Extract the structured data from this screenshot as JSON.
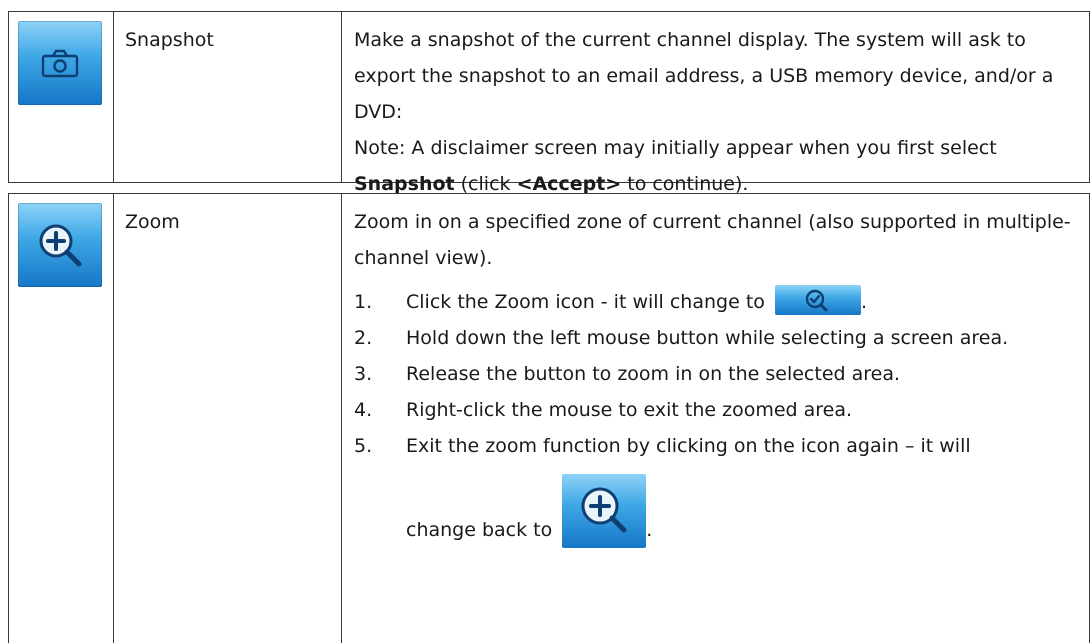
{
  "rows": [
    {
      "icon": "camera-icon",
      "name": "Snapshot",
      "description": {
        "line1": "Make a snapshot of the current channel display. The system will ask to export the snapshot to an email address, a USB memory device, and/or a DVD:",
        "note_prefix": "Note: A disclaimer screen may initially appear when you first select ",
        "note_bold1": "Snapshot",
        "note_mid": " (click ",
        "note_bold2": "<Accept>",
        "note_suffix": " to continue)."
      }
    },
    {
      "icon": "zoom-in-icon",
      "name": "Zoom",
      "description": {
        "intro": "Zoom in on a specified zone of current channel (also supported in multiple-channel view).",
        "steps": [
          {
            "num": "1.",
            "text": "Click the Zoom icon - it will change to ",
            "trailing": ".",
            "inline_icon": "zoom-active-icon"
          },
          {
            "num": "2.",
            "text": "Hold down the left mouse button while selecting a screen area."
          },
          {
            "num": "3.",
            "text": "Release the button to zoom in on the selected area."
          },
          {
            "num": "4.",
            "text": "Right-click the mouse to exit the zoomed area."
          },
          {
            "num": "5.",
            "text": "Exit the zoom function by clicking on the icon again – it will",
            "text2": "change back to ",
            "trailing": ".",
            "inline_icon": "zoom-in-icon"
          }
        ]
      }
    }
  ],
  "colors": {
    "icon_gradient_top": "#8ed3f7",
    "icon_gradient_bottom": "#1677c7",
    "border": "#3a3a3a",
    "text": "#1a1a1a"
  }
}
